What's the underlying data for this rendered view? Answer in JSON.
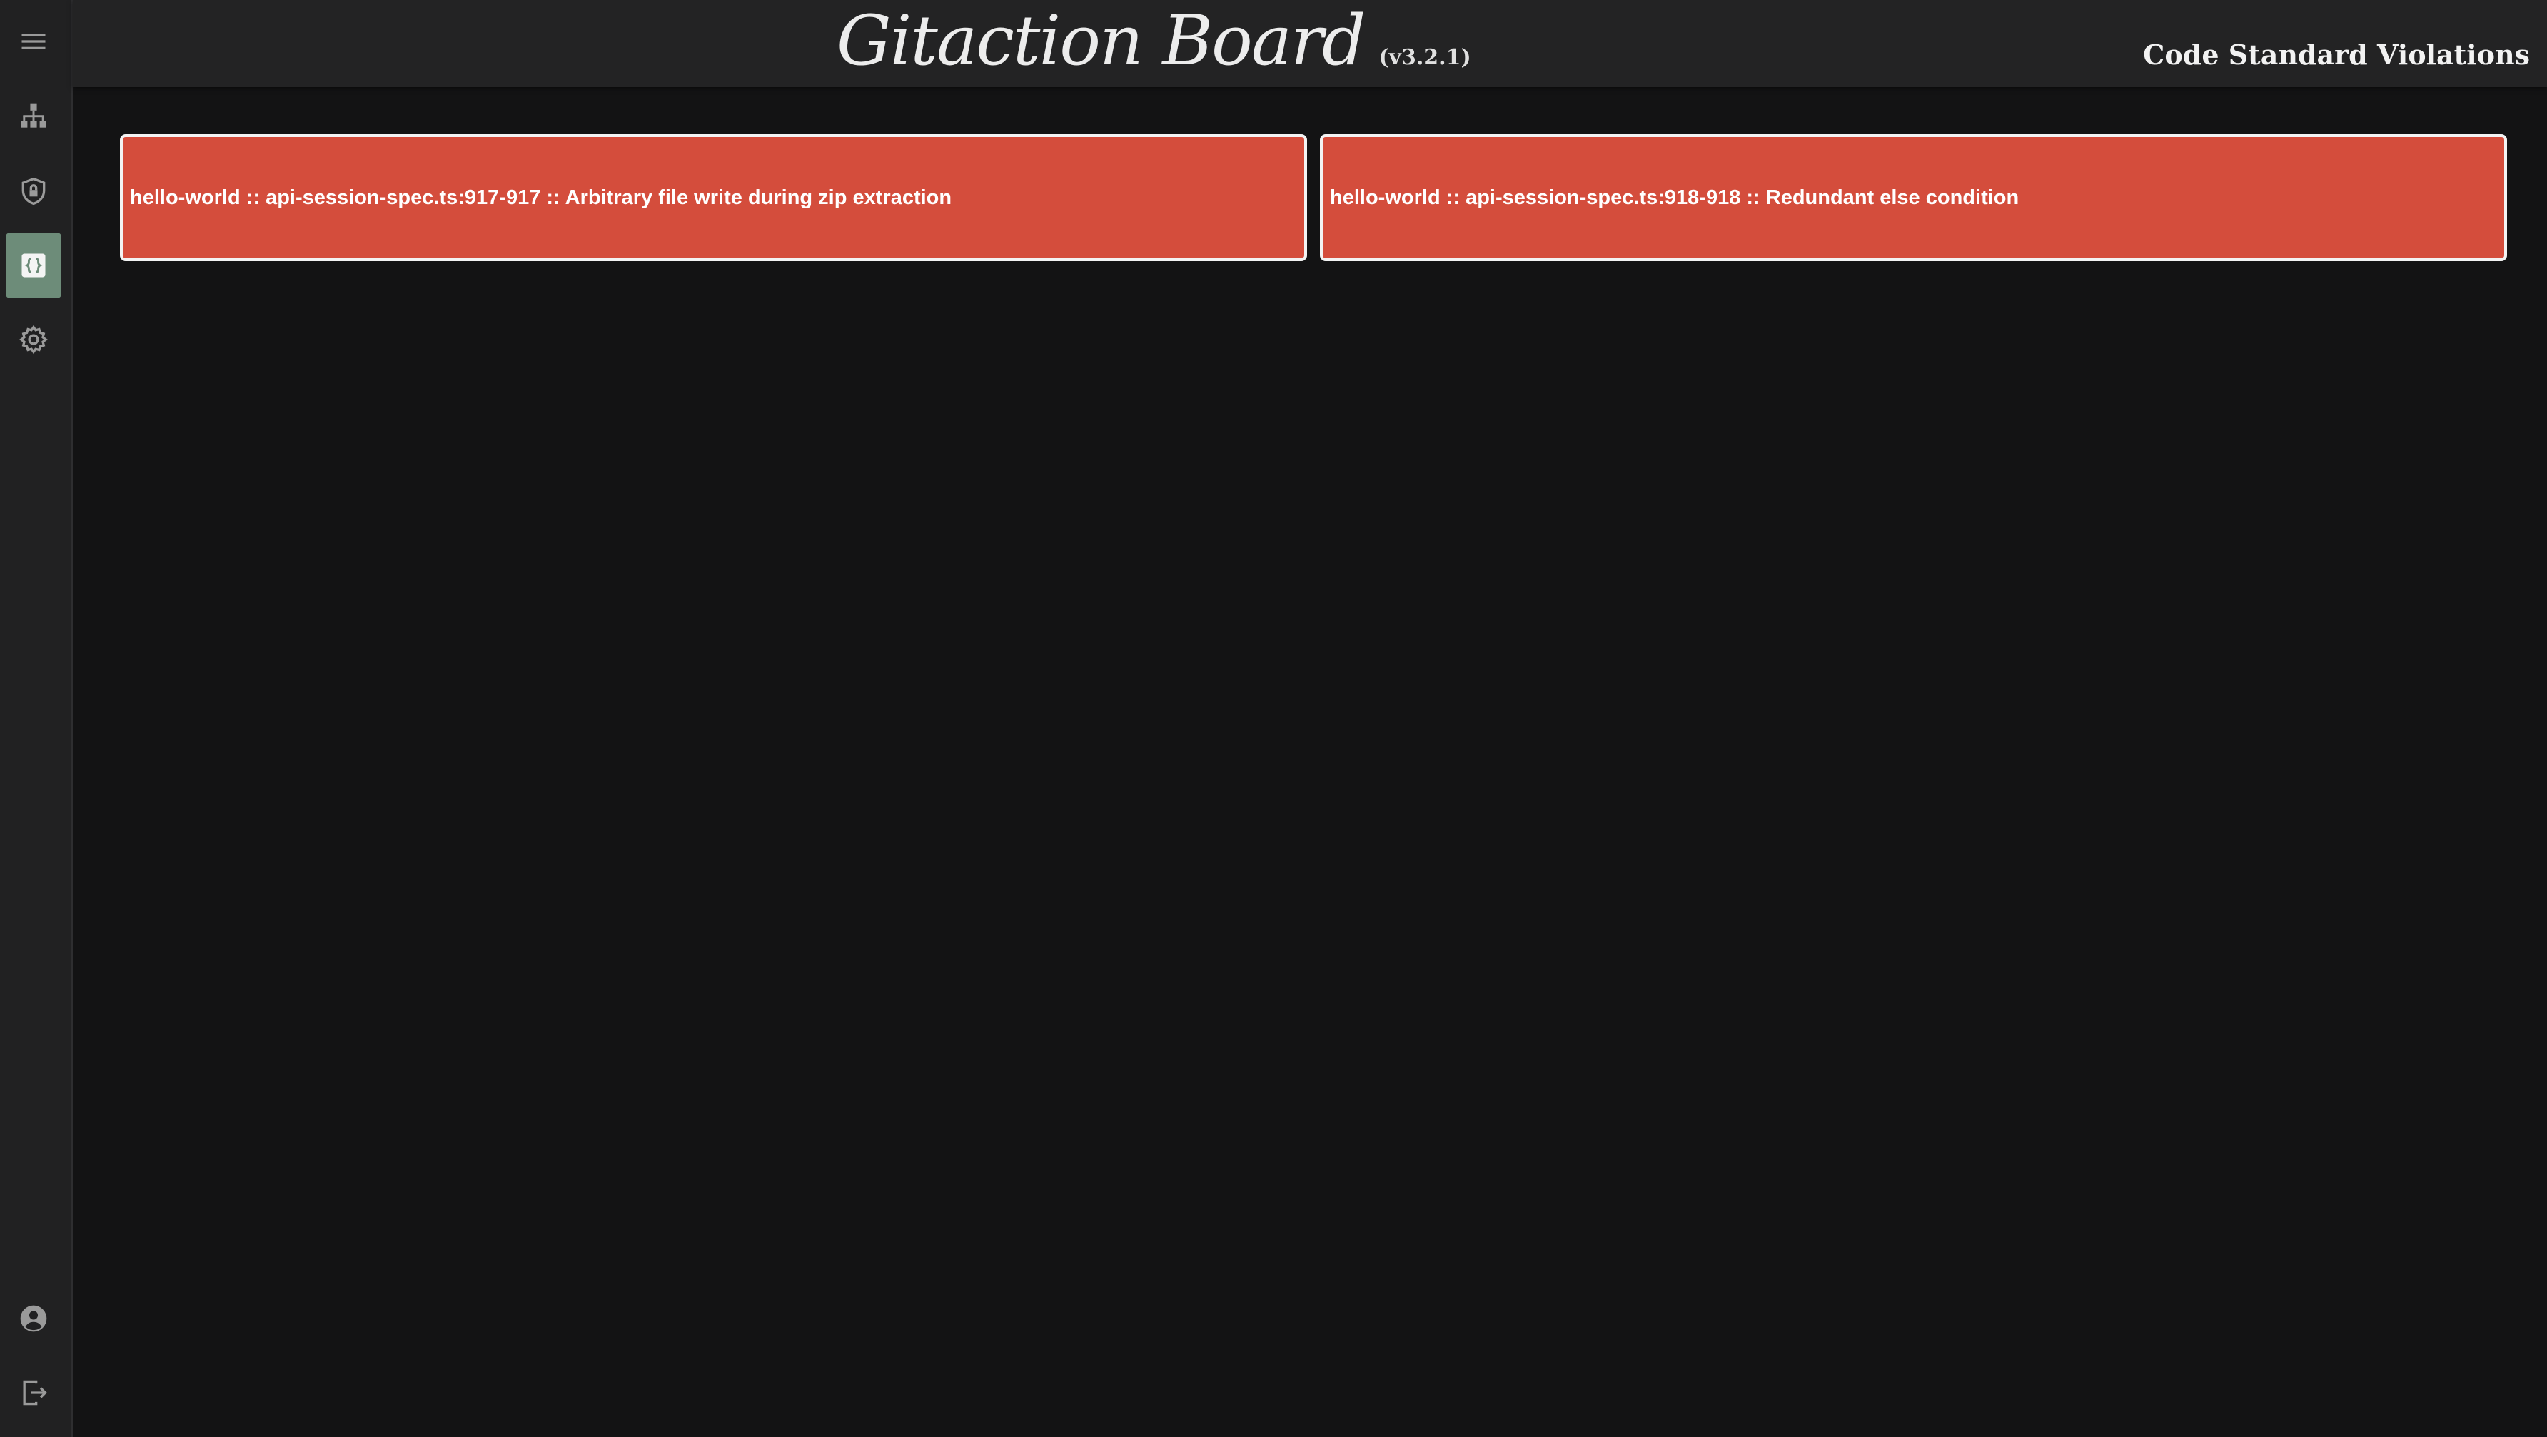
{
  "header": {
    "title": "Gitaction Board",
    "version": "(v3.2.1)",
    "section": "Code Standard Violations"
  },
  "sidebar": {
    "top_items": [
      {
        "icon": "menu-icon",
        "active": false
      },
      {
        "icon": "sitemap-icon",
        "active": false
      },
      {
        "icon": "shield-lock-icon",
        "active": false
      },
      {
        "icon": "code-braces-icon",
        "active": true
      },
      {
        "icon": "gear-icon",
        "active": false
      }
    ],
    "bottom_items": [
      {
        "icon": "account-circle-icon"
      },
      {
        "icon": "logout-icon"
      }
    ]
  },
  "violations": [
    {
      "label": "hello-world :: api-session-spec.ts:917-917 :: Arbitrary file write during zip extraction"
    },
    {
      "label": "hello-world :: api-session-spec.ts:918-918 :: Redundant else condition"
    }
  ],
  "colors": {
    "background": "#131314",
    "sidebar": "#212122",
    "topbar": "#232324",
    "active_nav": "#6d8c79",
    "violation_card": "#d44d3c"
  }
}
